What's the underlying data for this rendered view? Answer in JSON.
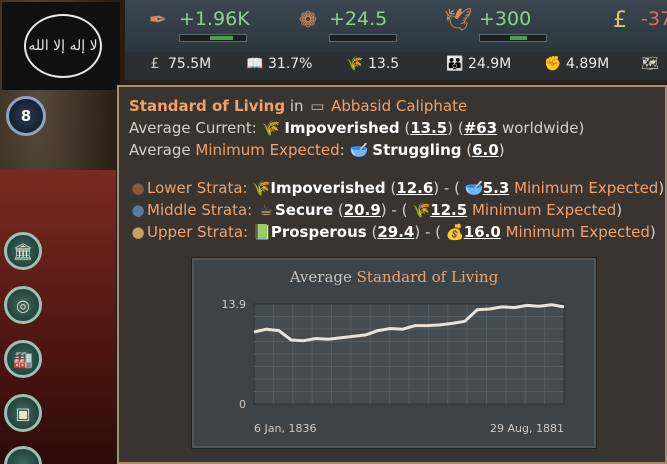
{
  "flag": {
    "emblem_text": "لا إله إلا الله",
    "rank": "8"
  },
  "topbar": [
    {
      "icon": "quill-icon",
      "glyph": "✒",
      "value": "+1.96K",
      "value_color": "#8ed18b",
      "bar_fill": 0.35
    },
    {
      "icon": "seal-icon",
      "glyph": "❁",
      "value": "+24.5",
      "value_color": "#8ed18b",
      "bar_fill": 0.0
    },
    {
      "icon": "dove-icon",
      "glyph": "🕊",
      "value": "+300",
      "value_color": "#8ed18b",
      "bar_fill": 0.25
    },
    {
      "icon": "pound-icon",
      "glyph": "£",
      "value": "-37",
      "value_color": "#e56b5b"
    }
  ],
  "subbar": [
    {
      "icon": "treasury-icon",
      "glyph": "£",
      "value": "75.5M"
    },
    {
      "icon": "literacy-icon",
      "glyph": "📖",
      "value": "31.7%"
    },
    {
      "icon": "wheat-icon",
      "glyph": "🌾",
      "value": "13.5"
    },
    {
      "icon": "population-icon",
      "glyph": "👪",
      "value": "24.9M"
    },
    {
      "icon": "fist-icon",
      "glyph": "✊",
      "value": "4.89M"
    },
    {
      "icon": "map-icon",
      "glyph": "🗺",
      "value": ""
    }
  ],
  "tooltip": {
    "title": "Standard of Living",
    "in": "in",
    "country": "Abbasid Caliphate",
    "avg_current_label": "Average Current:",
    "avg_current_status": "Impoverished",
    "avg_current_value": "13.5",
    "avg_current_rank": "#63",
    "worldwide": "worldwide",
    "avg_min_label_a": "Average",
    "avg_min_label_b": "Minimum Expected",
    "avg_min_status": "Struggling",
    "avg_min_value": "6.0",
    "strata": [
      {
        "icon": "lower-strata-icon",
        "glyph": "●",
        "icon_color": "#8a5a3a",
        "label": "Lower Strata:",
        "status_icon": "🌾",
        "status": "Impoverished",
        "value": "12.6",
        "min_icon": "🥣",
        "min_value": "5.3",
        "min_label": "Minimum Expected"
      },
      {
        "icon": "middle-strata-icon",
        "glyph": "●",
        "icon_color": "#5a7aa0",
        "label": "Middle Strata:",
        "status_icon": "☕",
        "status": "Secure",
        "value": "20.9",
        "min_icon": "🌾",
        "min_value": "12.5",
        "min_label": "Minimum Expected"
      },
      {
        "icon": "upper-strata-icon",
        "glyph": "●",
        "icon_color": "#c8a060",
        "label": "Upper Strata:",
        "status_icon": "📗",
        "status": "Prosperous",
        "value": "29.4",
        "min_icon": "💰",
        "min_value": "16.0",
        "min_label": "Minimum Expected"
      }
    ]
  },
  "chart_data": {
    "type": "line",
    "title_a": "Average",
    "title_b": "Standard of Living",
    "x_start_label": "6 Jan, 1836",
    "x_end_label": "29 Aug, 1881",
    "ylim": [
      0,
      13.9
    ],
    "y_ticks": [
      "13.9",
      "0"
    ],
    "grid": true,
    "series": [
      {
        "values": [
          10.0,
          10.4,
          10.2,
          8.9,
          8.8,
          9.1,
          9.0,
          9.2,
          9.4,
          9.6,
          10.2,
          10.5,
          10.4,
          10.9,
          10.9,
          11.0,
          11.2,
          11.5,
          13.1,
          13.2,
          13.5,
          13.4,
          13.7,
          13.6,
          13.8,
          13.5
        ]
      }
    ]
  }
}
